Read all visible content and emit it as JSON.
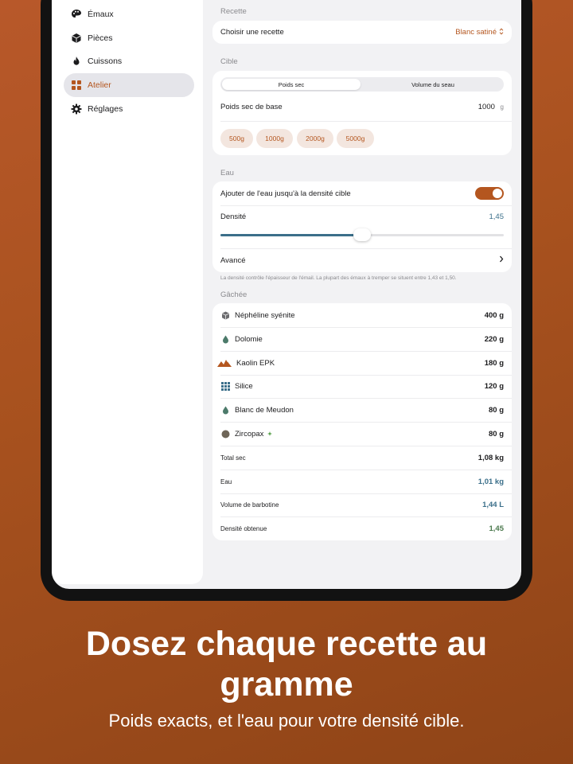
{
  "sidebar": {
    "items": [
      {
        "label": "Émaux",
        "icon": "palette-icon",
        "active": false
      },
      {
        "label": "Pièces",
        "icon": "cube-icon",
        "active": false
      },
      {
        "label": "Cuissons",
        "icon": "flame-icon",
        "active": false
      },
      {
        "label": "Atelier",
        "icon": "grid-icon",
        "active": true
      },
      {
        "label": "Réglages",
        "icon": "gear-icon",
        "active": false
      }
    ]
  },
  "recette": {
    "section_label": "Recette",
    "row_label": "Choisir une recette",
    "selected": "Blanc satiné"
  },
  "cible": {
    "section_label": "Cible",
    "segments": [
      "Poids sec",
      "Volume du seau"
    ],
    "selected_segment": "Poids sec",
    "base_label": "Poids sec de base",
    "base_value": "1000",
    "base_unit": "g",
    "chips": [
      "500g",
      "1000g",
      "2000g",
      "5000g"
    ]
  },
  "eau": {
    "section_label": "Eau",
    "toggle_label": "Ajouter de l'eau jusqu'à la densité cible",
    "toggle_on": true,
    "density_label": "Densité",
    "density_value": "1,45",
    "slider_fraction": 0.5,
    "advanced_label": "Avancé",
    "footnote": "La densité contrôle l'épaisseur de l'émail. La plupart des émaux à tremper se situent entre 1,43 et 1,50."
  },
  "gachee": {
    "section_label": "Gâchée",
    "ingredients": [
      {
        "name": "Néphéline syénite",
        "amount": "400 g",
        "icon": "box-icon"
      },
      {
        "name": "Dolomie",
        "amount": "220 g",
        "icon": "drop-icon"
      },
      {
        "name": "Kaolin EPK",
        "amount": "180 g",
        "icon": "mountain-icon"
      },
      {
        "name": "Silice",
        "amount": "120 g",
        "icon": "dots-grid-icon"
      },
      {
        "name": "Blanc de Meudon",
        "amount": "80 g",
        "icon": "drop-icon"
      },
      {
        "name": "Zircopax",
        "amount": "80 g",
        "icon": "circle-icon",
        "extra": "sparkle-icon"
      }
    ],
    "totals": [
      {
        "label": "Total sec",
        "value": "1,08 kg",
        "color": "#1c1c1e"
      },
      {
        "label": "Eau",
        "value": "1,01 kg",
        "color": "#3b6f8a"
      },
      {
        "label": "Volume de barbotine",
        "value": "1,44 L",
        "color": "#3b6f8a"
      },
      {
        "label": "Densité obtenue",
        "value": "1,45",
        "color": "#4c7a4e"
      }
    ]
  },
  "promo": {
    "headline_line1": "Dosez chaque recette au",
    "headline_line2": "gramme",
    "subtitle": "Poids exacts, et l'eau pour votre densité cible."
  },
  "colors": {
    "accent": "#b4561f",
    "blue": "#3b6f8a",
    "green": "#4c7a4e",
    "background": "#a9521f"
  }
}
